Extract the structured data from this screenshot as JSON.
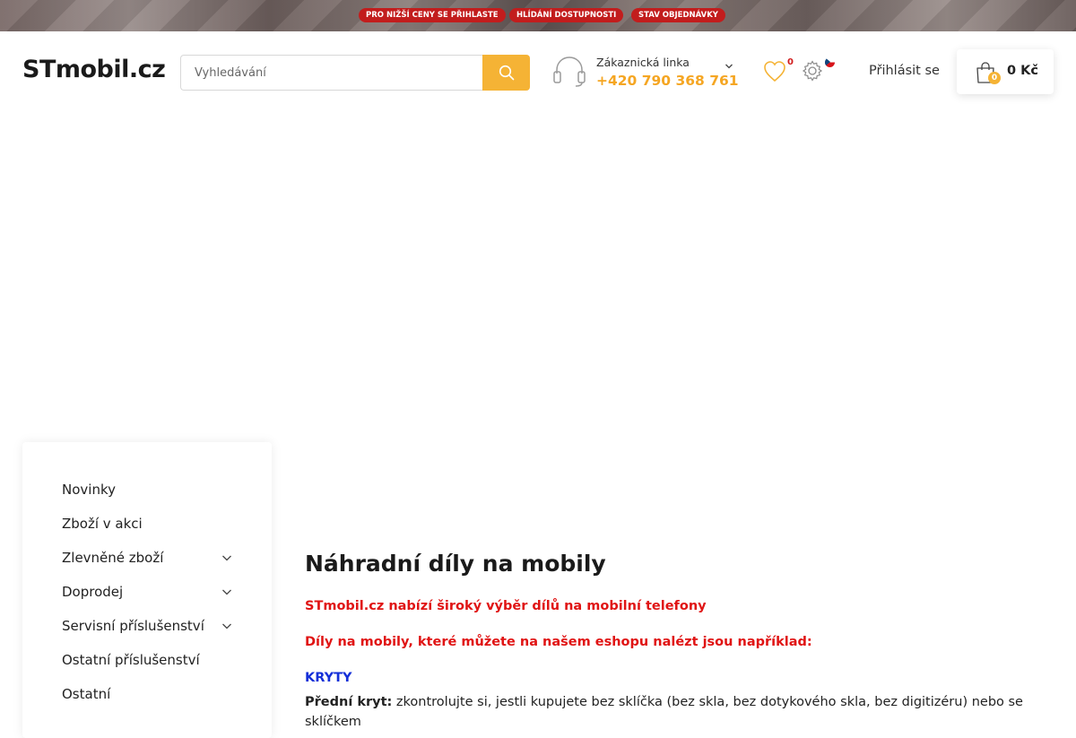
{
  "promo": {
    "pills": [
      "PRO NIŽŠÍ CENY SE PŘIHLASTE",
      "HLÍDÁNÍ DOSTUPNOSTI",
      "STAV OBJEDNÁVKY"
    ]
  },
  "header": {
    "logo": "STmobil.cz",
    "search_placeholder": "Vyhledávání",
    "support_label": "Zákaznická linka",
    "support_phone": "+420 790 368 761",
    "wishlist_count": "0",
    "login_label": "Přihlásit se",
    "cart_count": "0",
    "cart_total": "0 Kč"
  },
  "sidebar": {
    "items": [
      {
        "label": "Novinky",
        "has_submenu": false
      },
      {
        "label": "Zboží v akci",
        "has_submenu": false
      },
      {
        "label": "Zlevněné zboží",
        "has_submenu": true
      },
      {
        "label": "Doprodej",
        "has_submenu": true
      },
      {
        "label": "Servisní příslušenství",
        "has_submenu": true
      },
      {
        "label": "Ostatní příslušenství",
        "has_submenu": false
      },
      {
        "label": "Ostatní",
        "has_submenu": false
      }
    ]
  },
  "main": {
    "title": "Náhradní díly na mobily",
    "intro1": "STmobil.cz nabízí široký výběr dílů na mobilní telefony",
    "intro2": "Díly na mobily, které můžete na našem eshopu nalézt jsou například:",
    "section_heading": "KRYTY",
    "para_term": "Přední kryt:",
    "para_text": " zkontrolujte si, jestli kupujete bez sklíčka (bez skla, bez dotykového skla, bez digitizéru) nebo se sklíčkem"
  },
  "colors": {
    "accent": "#f5b335",
    "phone": "#f5a623",
    "red": "#e01414",
    "blue": "#1530d8",
    "promo_pill": "#c21d1d"
  }
}
